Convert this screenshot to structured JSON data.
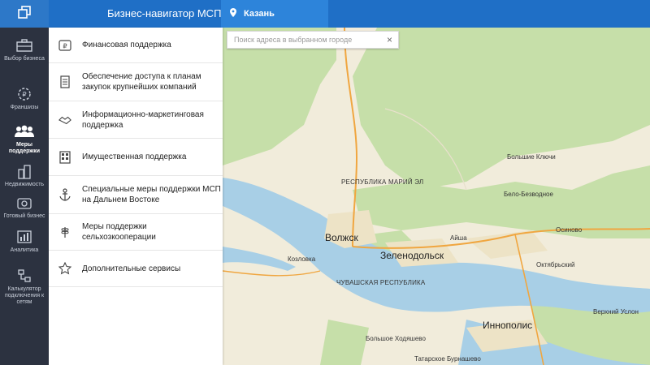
{
  "app": {
    "title": "Бизнес-навигатор МСП",
    "city": "Казань"
  },
  "sidebar": {
    "items": [
      {
        "label": "Выбор бизнеса",
        "icon": "briefcase-icon"
      },
      {
        "label": "Франшизы",
        "icon": "franchise-icon"
      },
      {
        "label": "Меры поддержки",
        "icon": "people-icon",
        "active": true
      },
      {
        "label": "Недвижимость",
        "icon": "buildings-icon"
      },
      {
        "label": "Готовый бизнес",
        "icon": "ready-business-icon"
      },
      {
        "label": "Аналитика",
        "icon": "analytics-icon"
      },
      {
        "label": "Калькулятор подключения к сетям",
        "icon": "pipes-icon"
      }
    ]
  },
  "menu": {
    "items": [
      {
        "label": "Финансовая поддержка",
        "icon": "ruble-card-icon"
      },
      {
        "label": "Обеспечение доступа к планам закупок крупнейших компаний",
        "icon": "document-icon"
      },
      {
        "label": "Информационно-маркетинговая поддержка",
        "icon": "handshake-icon"
      },
      {
        "label": "Имущественная поддержка",
        "icon": "property-icon"
      },
      {
        "label": "Специальные меры поддержки МСП на Дальнем Востоке",
        "icon": "anchor-icon"
      },
      {
        "label": "Меры поддержки сельхозкооперации",
        "icon": "wheat-icon"
      },
      {
        "label": "Дополнительные сервисы",
        "icon": "star-icon"
      }
    ]
  },
  "map": {
    "search_placeholder": "Поиск адреса в выбранном городе",
    "labels": {
      "mari_el": "РЕСПУБЛИКА МАРИЙ ЭЛ",
      "chuvash": "ЧУВАШСКАЯ РЕСПУБЛИКА",
      "volzhsk": "Волжск",
      "zelenodolsk": "Зеленодольск",
      "innopolis": "Иннополис",
      "kozlovka": "Козловка",
      "bolshie_klyuchi": "Большие Ключи",
      "belo_bezvodnoe": "Бело-Безводное",
      "osinovo": "Осиново",
      "aysha": "Айша",
      "oktyabrsky": "Октябрьский",
      "verkhny_uslon": "Верхний Услон",
      "bolshoe_khodyashevo": "Большое Ходяшево",
      "tatarskoe_burnashevo": "Татарское Бурнашево"
    }
  },
  "colors": {
    "header": "#1f6fc6",
    "city_tab": "#2d84da",
    "sidebar": "#2c3240",
    "forest": "#c6dfa9",
    "water": "#a8cfe6",
    "road": "#f0a640"
  }
}
